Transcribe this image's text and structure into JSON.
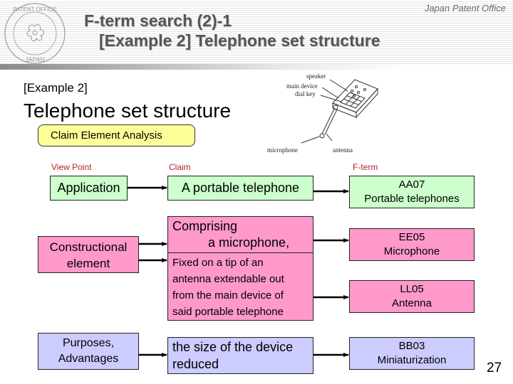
{
  "header": {
    "title_line1": "F-term search (2)-1",
    "title_line2": "[Example 2] Telephone set structure",
    "organization": "Japan Patent Office",
    "seal_text_top": "PATENT OFFICE",
    "seal_text_bottom": "JAPAN"
  },
  "slide": {
    "example_label": "[Example 2]",
    "main_title": "Telephone set structure",
    "analysis_label": "Claim Element Analysis",
    "page_number": "27"
  },
  "figure": {
    "labels": {
      "speaker": "speaker",
      "main_device": "main device",
      "dial_key": "dial key",
      "microphone": "microphone",
      "antenna": "antenna"
    }
  },
  "columns": {
    "view_point": "View Point",
    "claim": "Claim",
    "fterm": "F-term"
  },
  "rows": {
    "application": {
      "view_point": "Application",
      "claim": "A portable telephone",
      "fterm_code": "AA07",
      "fterm_desc": "Portable telephones"
    },
    "constructional": {
      "view_point_lines": [
        "Constructional",
        "element"
      ],
      "claim_a_lines": [
        "Comprising",
        "a microphone,"
      ],
      "claim_b_lines": [
        "Fixed on a tip of an",
        "antenna extendable out",
        "from the main device of",
        "said portable telephone"
      ],
      "fterm_a_code": "EE05",
      "fterm_a_desc": "Microphone",
      "fterm_b_code": "LL05",
      "fterm_b_desc": "Antenna"
    },
    "purposes": {
      "view_point_lines": [
        "Purposes,",
        "Advantages"
      ],
      "claim_lines": [
        "the size of the device",
        "reduced"
      ],
      "fterm_code": "BB03",
      "fterm_desc": "Miniaturization"
    }
  },
  "colors": {
    "application": "#ccffcc",
    "constructional": "#ff99cc",
    "purposes": "#ccccff",
    "analysis_box": "#ffff99",
    "column_heading": "#b21f2d"
  }
}
